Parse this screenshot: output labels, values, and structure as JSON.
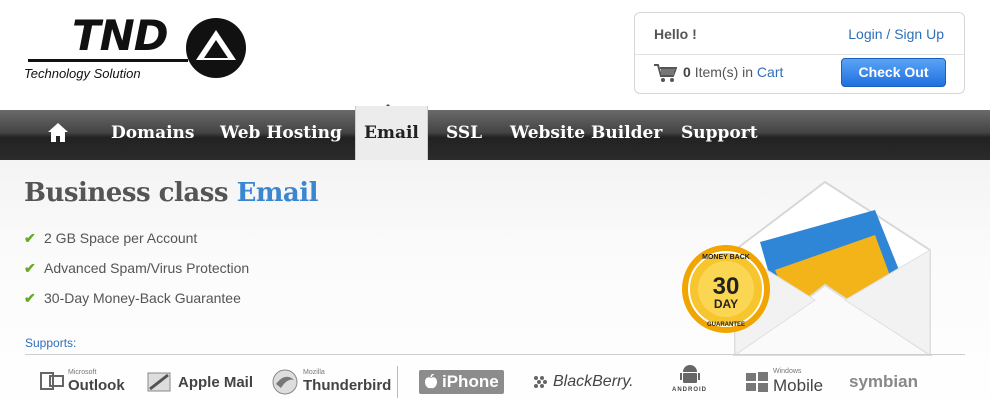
{
  "brand": {
    "logo_text": "TND",
    "tagline": "Technology Solution"
  },
  "account": {
    "greeting": "Hello !",
    "login_link": "Login / Sign Up",
    "cart_count": "0",
    "cart_items_text": "Item(s) in",
    "cart_link": "Cart",
    "checkout_label": "Check Out"
  },
  "nav": {
    "items": [
      {
        "label": "Domains"
      },
      {
        "label": "Web Hosting"
      },
      {
        "label": "Email",
        "active": true
      },
      {
        "label": "SSL"
      },
      {
        "label": "Website Builder"
      },
      {
        "label": "Support"
      }
    ],
    "home_icon": "home-icon"
  },
  "hero": {
    "title_prefix": "Business class",
    "title_accent": "Email",
    "features": [
      "2 GB Space per Account",
      "Advanced Spam/Virus Protection",
      "30-Day Money-Back Guarantee"
    ],
    "badge": {
      "top": "MONEY BACK",
      "big": "30",
      "day": "DAY",
      "bottom": "GUARANTEE"
    },
    "supports_label": "Supports:",
    "clients": [
      {
        "small": "Microsoft",
        "name": "Outlook",
        "icon": "outlook-icon"
      },
      {
        "small": "",
        "name": "Apple Mail",
        "icon": "apple-mail-icon"
      },
      {
        "small": "Mozilla",
        "name": "Thunderbird",
        "icon": "thunderbird-icon"
      },
      {
        "small": "",
        "name": "iPhone",
        "icon": "apple-icon"
      },
      {
        "small": "",
        "name": "BlackBerry.",
        "icon": "blackberry-icon"
      },
      {
        "small": "",
        "name": "ANDROID",
        "icon": "android-icon"
      },
      {
        "small": "Windows",
        "name": "Mobile",
        "icon": "windows-icon"
      },
      {
        "small": "",
        "name": "symbian",
        "icon": ""
      }
    ]
  },
  "colors": {
    "accent": "#3a86d1",
    "link": "#2f6fb7",
    "check": "#6aa82a",
    "button": "#1f6fe0",
    "nav_dark": "#2b2b2b"
  }
}
